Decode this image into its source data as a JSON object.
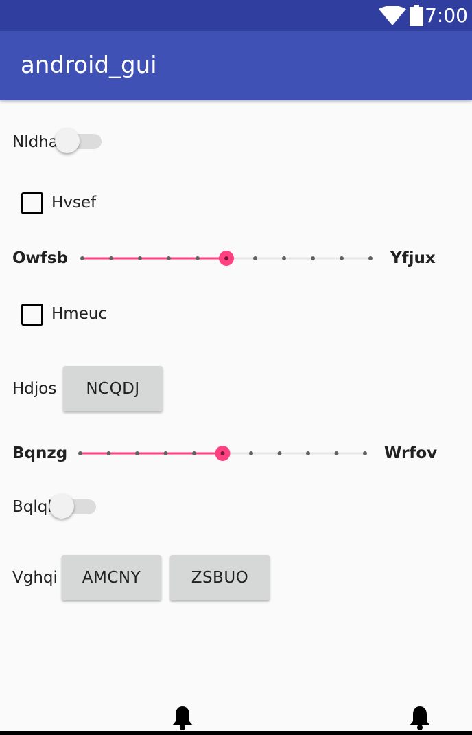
{
  "status_bar": {
    "time": "7:00"
  },
  "app_bar": {
    "title": "android_gui"
  },
  "rows": {
    "switch1": {
      "label": "Nldha",
      "checked": false
    },
    "checkbox1": {
      "label": "Hvsef",
      "checked": false
    },
    "slider1": {
      "label_left": "Owfsb",
      "label_right": "Yfjux",
      "steps": 10,
      "value": 5
    },
    "checkbox2": {
      "label": "Hmeuc",
      "checked": false
    },
    "button_row1": {
      "label": "Hdjos",
      "button": "NCQDJ"
    },
    "slider2": {
      "label_left": "Bqnzg",
      "label_right": "Wrfov",
      "steps": 10,
      "value": 5
    },
    "switch2": {
      "label": "Bqlql",
      "checked": false
    },
    "button_row2": {
      "label": "Vghqi",
      "buttons": [
        "AMCNY",
        "ZSBUO"
      ]
    }
  },
  "colors": {
    "primary": "#3f51b5",
    "primary_dark": "#303f9f",
    "accent": "#ff4081"
  },
  "icons": [
    "wifi-icon",
    "battery-icon",
    "bell-icon"
  ]
}
